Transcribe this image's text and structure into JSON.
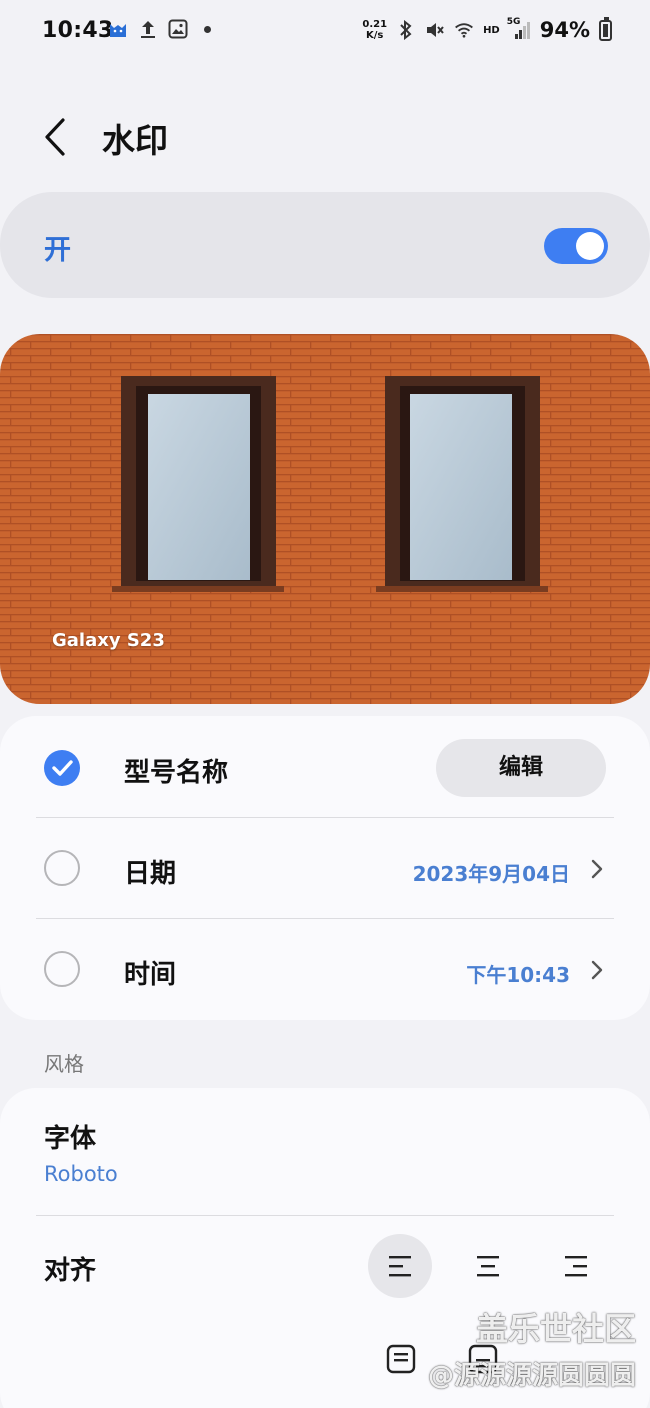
{
  "status_bar": {
    "time": "10:43",
    "net_speed_value": "0.21",
    "net_speed_unit": "K/s",
    "network_tag": "HD",
    "signal_tag": "5G",
    "battery_percent": "94%"
  },
  "header": {
    "title": "水印"
  },
  "master_toggle": {
    "label": "开",
    "on": true
  },
  "preview": {
    "watermark_text": "Galaxy S23"
  },
  "options": [
    {
      "label": "型号名称",
      "checked": true,
      "action_label": "编辑"
    },
    {
      "label": "日期",
      "checked": false,
      "value": "2023年9月04日"
    },
    {
      "label": "时间",
      "checked": false,
      "value": "下午10:43"
    }
  ],
  "style_section": {
    "heading": "风格",
    "font_title": "字体",
    "font_value": "Roboto",
    "align_title": "对齐",
    "align_options": [
      "align-left",
      "align-center",
      "align-right"
    ],
    "align_selected": "align-left"
  },
  "overlay_watermark": {
    "line1": "盖乐世社区",
    "line2": "@源源源源圆圆圆"
  },
  "colors": {
    "accent": "#3e7ef2",
    "value_text": "#4a7fd1",
    "background": "#f2f2f6",
    "brick": "#c8632e"
  }
}
